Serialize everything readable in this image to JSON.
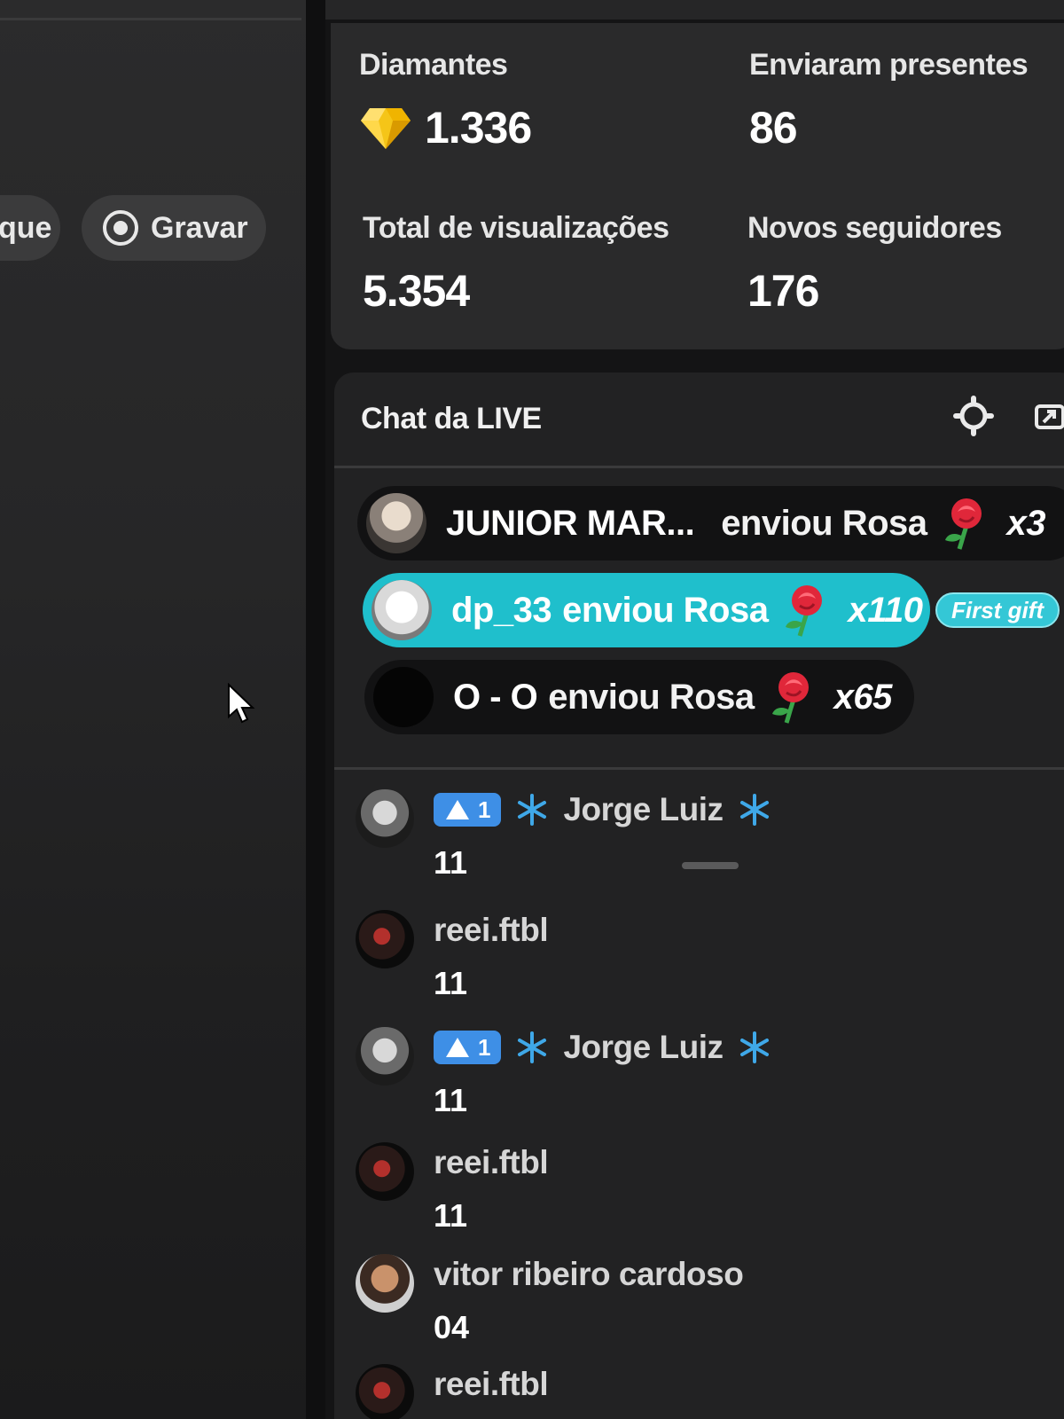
{
  "left_panel": {
    "partial_button_label": "que",
    "record_button_label": "Gravar"
  },
  "stats": {
    "diamonds": {
      "label": "Diamantes",
      "value": "1.336"
    },
    "gift_senders": {
      "label": "Enviaram presentes",
      "value": "86"
    },
    "total_views": {
      "label": "Total de visualizações",
      "value": "5.354"
    },
    "new_followers": {
      "label": "Novos seguidores",
      "value": "176"
    }
  },
  "chat": {
    "title": "Chat da LIVE",
    "gifts": [
      {
        "user": "JUNIOR MAR...",
        "text": "enviou Rosa",
        "multiplier": "x3",
        "highlight": false
      },
      {
        "user": "dp_33",
        "text": "enviou Rosa",
        "multiplier": "x110",
        "highlight": true,
        "badge": "First gift"
      },
      {
        "user": "O - O",
        "text": "enviou Rosa",
        "multiplier": "x65",
        "highlight": false
      }
    ],
    "messages": [
      {
        "level": "1",
        "user": "Jorge Luiz",
        "text": "11"
      },
      {
        "user": "reei.ftbl",
        "text": "11"
      },
      {
        "level": "1",
        "user": "Jorge Luiz",
        "text": "11"
      },
      {
        "user": "reei.ftbl",
        "text": "11"
      },
      {
        "user": "vitor ribeiro cardoso",
        "text": "04"
      },
      {
        "user": "reei.ftbl",
        "text": ""
      }
    ]
  },
  "colors": {
    "highlight": "#1fbfcc",
    "badge": "#3e8fe6",
    "diamond": "#f5c518"
  }
}
